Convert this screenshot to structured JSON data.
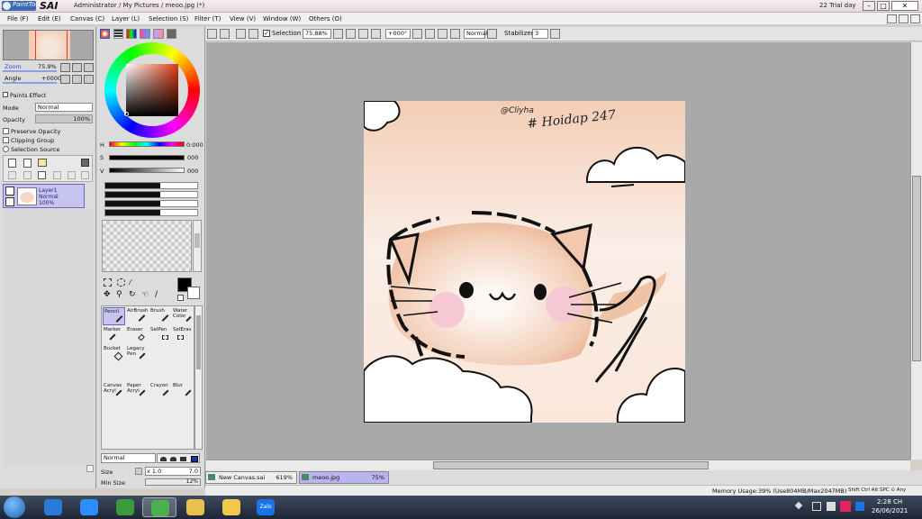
{
  "titlebar": {
    "logo_text": "PaintTool",
    "app_name": "SAI",
    "title": "Administrator / My Pictures / meoo.jpg (*)",
    "trial": "22 Trial day"
  },
  "menu": [
    "File (F)",
    "Edit (E)",
    "Canvas (C)",
    "Layer (L)",
    "Selection (S)",
    "Filter (T)",
    "View (V)",
    "Window (W)",
    "Others (O)"
  ],
  "toolbar": {
    "selection_label": "Selection",
    "zoom_value": "75.88%",
    "rotation_value": "+000°",
    "mode_value": "Normal",
    "stabilizer_label": "Stabilizer",
    "stabilizer_value": "3"
  },
  "navigator": {
    "zoom_label": "Zoom",
    "zoom_value": "75.9%",
    "angle_label": "Angle",
    "angle_value": "+0000"
  },
  "layer_panel": {
    "paints_effect": "Paints Effect",
    "mode_label": "Mode",
    "mode_value": "Normal",
    "opacity_label": "Opacity",
    "opacity_value": "100%",
    "preserve_opacity": "Preserve Opacity",
    "clipping_group": "Clipping Group",
    "selection_source": "Selection Source",
    "layer_name": "Layer1",
    "layer_mode": "Normal",
    "layer_opacity": "100%"
  },
  "color": {
    "h_label": "H",
    "h_value": "0:000",
    "s_label": "S",
    "s_value": "000",
    "v_label": "V",
    "v_value": "000",
    "main_color": "#000000",
    "sub_color": "#ffffff"
  },
  "tools": [
    {
      "label": "Pencil",
      "icon": "pencil-icon"
    },
    {
      "label": "AirBrush",
      "icon": "airbrush-icon"
    },
    {
      "label": "Brush",
      "icon": "brush-icon"
    },
    {
      "label": "Water Color",
      "icon": "watercolor-icon"
    },
    {
      "label": "Marker",
      "icon": "marker-icon"
    },
    {
      "label": "Eraser",
      "icon": "eraser-icon"
    },
    {
      "label": "SelPen",
      "icon": "selpen-icon"
    },
    {
      "label": "SelEras",
      "icon": "seleras-icon"
    },
    {
      "label": "Bucket",
      "icon": "bucket-icon"
    },
    {
      "label": "Legacy Pen",
      "icon": "legacy-pen-icon"
    },
    {
      "label": "",
      "icon": ""
    },
    {
      "label": "",
      "icon": ""
    },
    {
      "label": "Canvas Acryl",
      "icon": "canvas-acryl-icon"
    },
    {
      "label": "Paper Acryl",
      "icon": "paper-acryl-icon"
    },
    {
      "label": "Crayon",
      "icon": "crayon-icon"
    },
    {
      "label": "Blur",
      "icon": "blur-icon"
    }
  ],
  "tool_settings": {
    "blend_mode": "Normal",
    "size_label": "Size",
    "size_mult": "x 1.0",
    "size_value": "7.0",
    "min_size_label": "Min Size",
    "min_size_value": "12%"
  },
  "artwork": {
    "signature": "@Cliyha",
    "hashtag": "# Hoidap 247"
  },
  "tabs": [
    {
      "name": "New Canvas.sai",
      "zoom": "619%"
    },
    {
      "name": "meoo.jpg",
      "zoom": "75%"
    }
  ],
  "status": {
    "memory": "Memory Usage:39% (Use804MB/Max2047MB)",
    "keys": "Shift Ctrl Alt SPC ⊙ Any"
  },
  "taskbar": {
    "time": "2:28 CH",
    "date": "26/06/2021",
    "zalo_label": "Zalo"
  },
  "colors": {
    "accent": "#3a6ab0",
    "canvas_bg": "#a9a9a9",
    "peach": "#f2c8ae"
  }
}
